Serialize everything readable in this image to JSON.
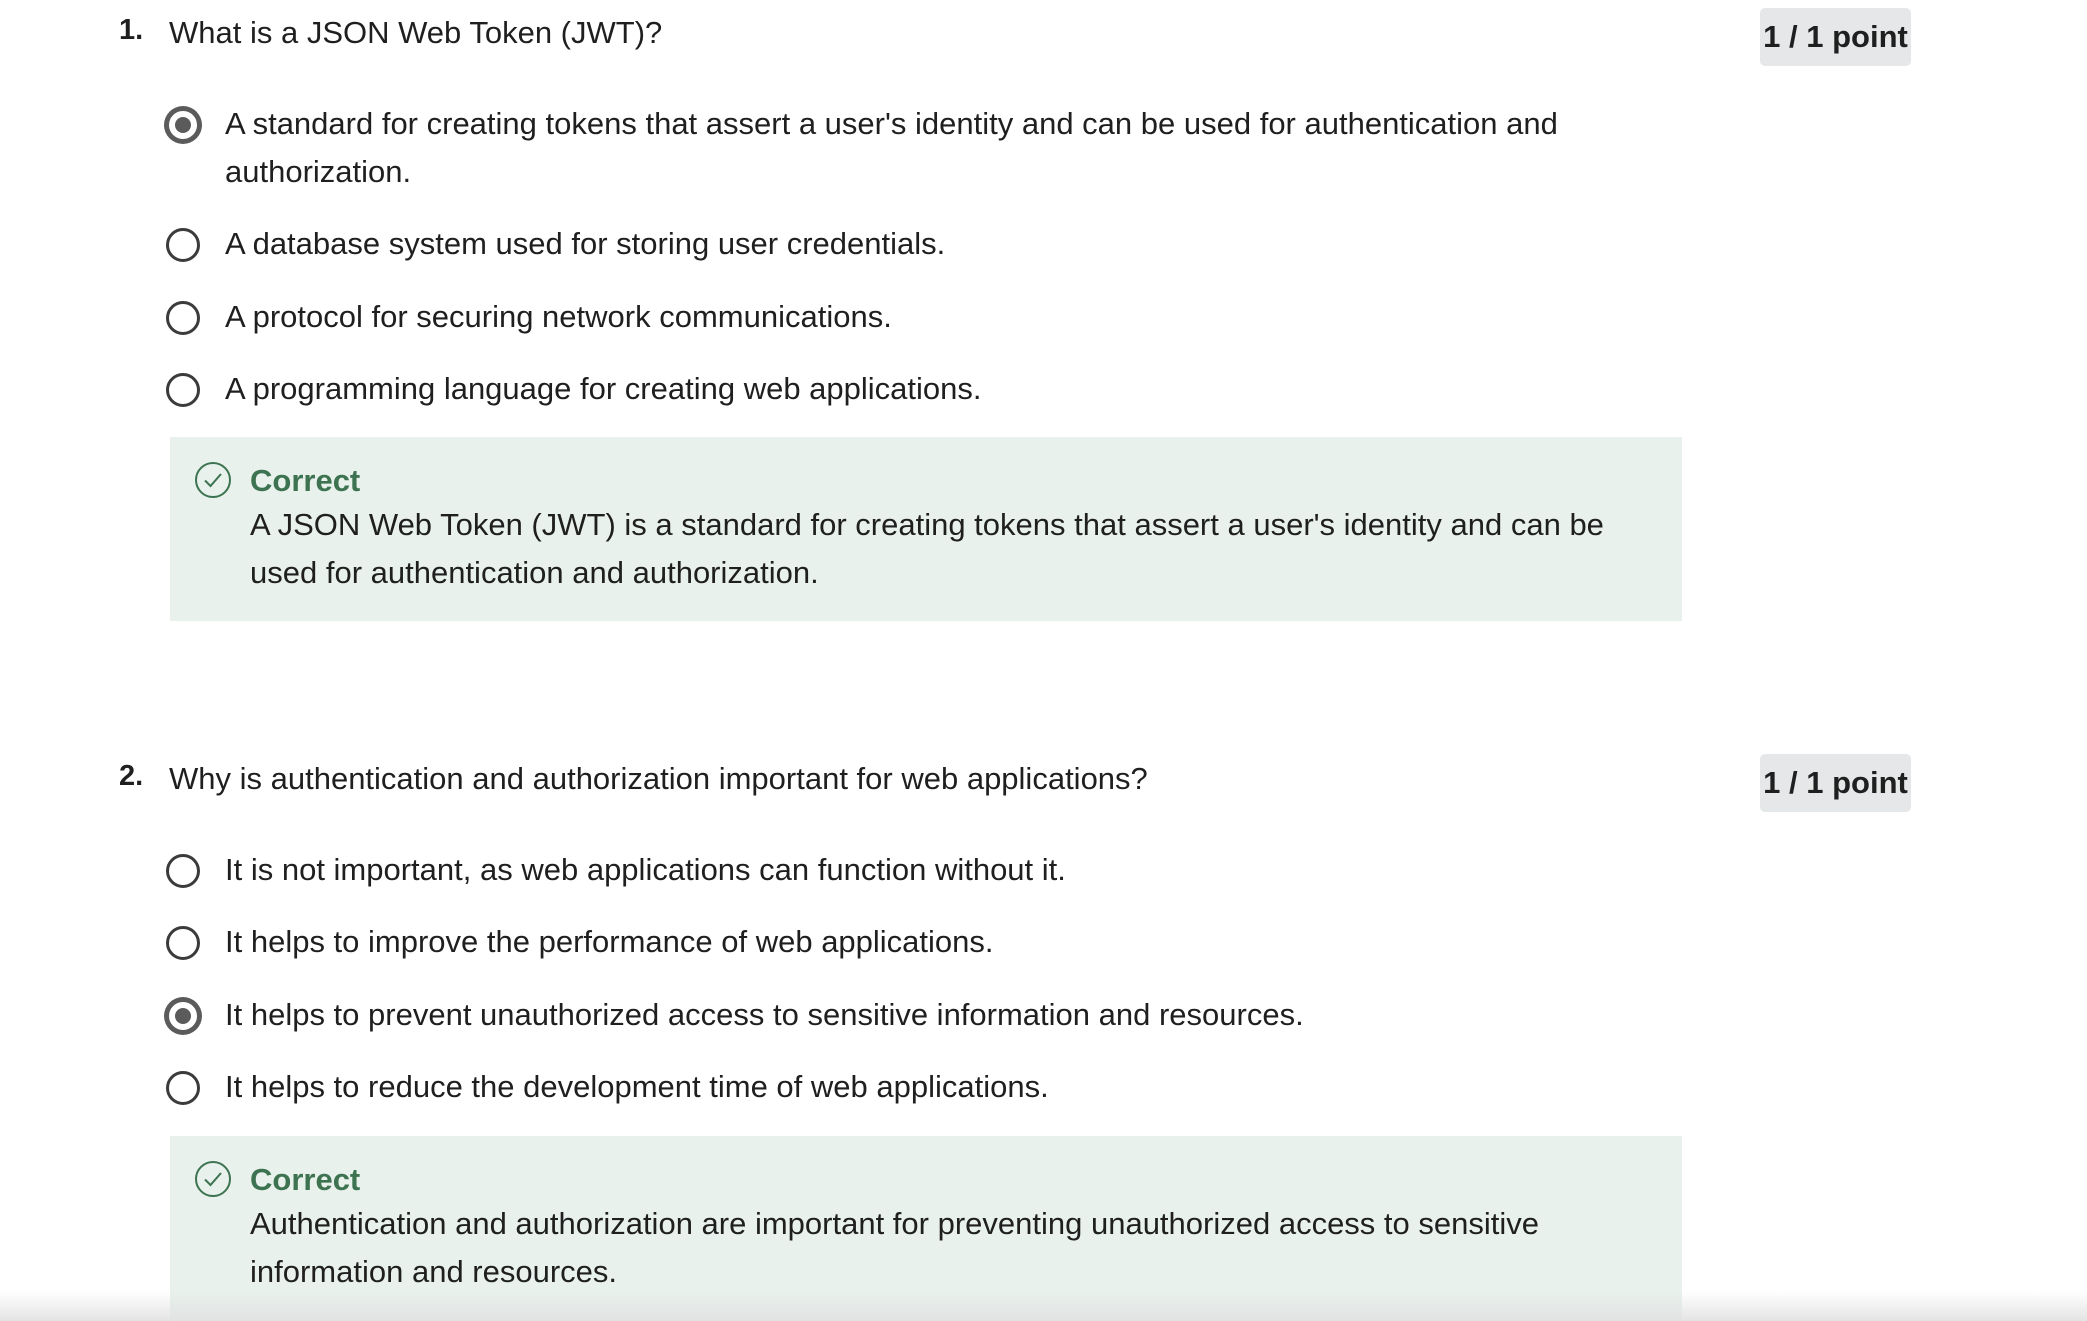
{
  "questions": [
    {
      "number": "1.",
      "text": "What is a JSON Web Token (JWT)?",
      "points": "1 / 1 point",
      "options": [
        {
          "label": "A standard for creating tokens that assert a user's identity and can be used for authentication and authorization.",
          "selected": true
        },
        {
          "label": "A database system used for storing user credentials.",
          "selected": false
        },
        {
          "label": "A protocol for securing network communications.",
          "selected": false
        },
        {
          "label": "A programming language for creating web applications.",
          "selected": false
        }
      ],
      "feedback": {
        "title": "Correct",
        "text": "A JSON Web Token (JWT) is a standard for creating tokens that assert a user's identity and can be used for authentication and authorization."
      }
    },
    {
      "number": "2.",
      "text": "Why is authentication and authorization important for web applications?",
      "points": "1 / 1 point",
      "options": [
        {
          "label": "It is not important, as web applications can function without it.",
          "selected": false
        },
        {
          "label": "It helps to improve the performance of web applications.",
          "selected": false
        },
        {
          "label": "It helps to prevent unauthorized access to sensitive information and resources.",
          "selected": true
        },
        {
          "label": "It helps to reduce the development time of web applications.",
          "selected": false
        }
      ],
      "feedback": {
        "title": "Correct",
        "text": "Authentication and authorization are important for preventing unauthorized access to sensitive information and resources."
      }
    }
  ],
  "colors": {
    "feedback_bg": "#e8f1ec",
    "correct_green": "#3d7350",
    "points_badge_bg": "#e5e7e8"
  },
  "icons": {
    "feedback_icon": "check-circle-icon",
    "selected_option": "radio-checked-icon",
    "unselected_option": "radio-unchecked-icon"
  }
}
